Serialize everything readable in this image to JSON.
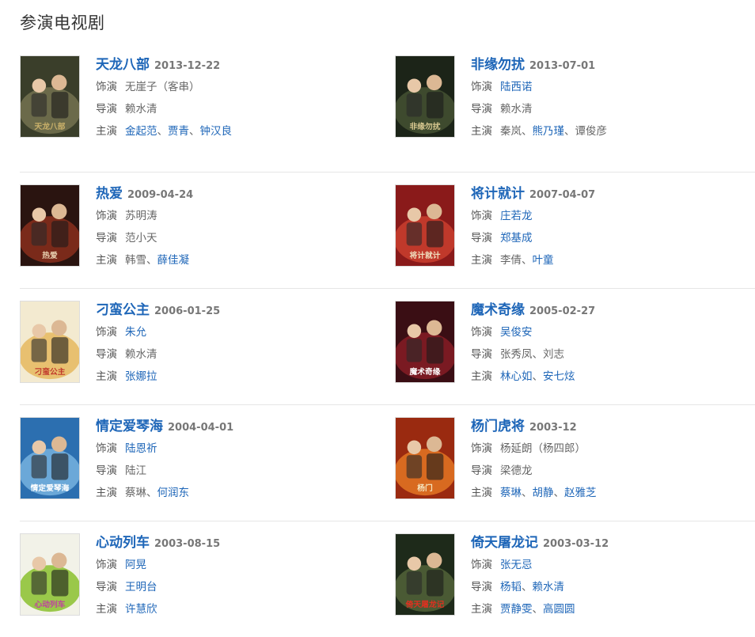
{
  "section": {
    "title": "参演电视剧"
  },
  "labels": {
    "role": "饰演",
    "director": "导演",
    "cast": "主演"
  },
  "separator": "、",
  "shows": [
    {
      "title": "天龙八部",
      "date": "2013-12-22",
      "role": [
        {
          "name": "无崖子（客串）",
          "link": false
        }
      ],
      "director": [
        {
          "name": "赖水清",
          "link": false
        }
      ],
      "cast": [
        {
          "name": "金起范",
          "link": true
        },
        {
          "name": "贾青",
          "link": true
        },
        {
          "name": "钟汉良",
          "link": true
        }
      ],
      "poster": {
        "bg": "#3a3e2a",
        "mid": "#6b6a4a",
        "accent": "#c9b06a",
        "text": "天龙八部"
      }
    },
    {
      "title": "非缘勿扰",
      "date": "2013-07-01",
      "role": [
        {
          "name": "陆西诺",
          "link": true
        }
      ],
      "director": [
        {
          "name": "赖水清",
          "link": false
        }
      ],
      "cast": [
        {
          "name": "秦岚",
          "link": false
        },
        {
          "name": "熊乃瑾",
          "link": true
        },
        {
          "name": "谭俊彦",
          "link": false
        }
      ],
      "poster": {
        "bg": "#1c2418",
        "mid": "#3e4a2e",
        "accent": "#d8c890",
        "text": "非缘勿扰"
      }
    },
    {
      "title": "热爱",
      "date": "2009-04-24",
      "role": [
        {
          "name": "苏明涛",
          "link": false
        }
      ],
      "director": [
        {
          "name": "范小天",
          "link": false
        }
      ],
      "cast": [
        {
          "name": "韩雪",
          "link": false
        },
        {
          "name": "薛佳凝",
          "link": true
        }
      ],
      "poster": {
        "bg": "#2a1410",
        "mid": "#7a2a1a",
        "accent": "#e8d0b0",
        "text": "热爱"
      }
    },
    {
      "title": "将计就计",
      "date": "2007-04-07",
      "role": [
        {
          "name": "庄若龙",
          "link": true
        }
      ],
      "director": [
        {
          "name": "郑基成",
          "link": true
        }
      ],
      "cast": [
        {
          "name": "李倩",
          "link": false
        },
        {
          "name": "叶童",
          "link": true
        }
      ],
      "poster": {
        "bg": "#8a1a1a",
        "mid": "#c0392b",
        "accent": "#f0e0c0",
        "text": "将计就计"
      }
    },
    {
      "title": "刁蛮公主",
      "date": "2006-01-25",
      "role": [
        {
          "name": "朱允",
          "link": true
        }
      ],
      "director": [
        {
          "name": "赖水清",
          "link": false
        }
      ],
      "cast": [
        {
          "name": "张娜拉",
          "link": true
        }
      ],
      "poster": {
        "bg": "#f3ead0",
        "mid": "#e8c070",
        "accent": "#c0392b",
        "text": "刁蛮公主"
      }
    },
    {
      "title": "魔术奇缘",
      "date": "2005-02-27",
      "role": [
        {
          "name": "吴俊安",
          "link": true
        }
      ],
      "director": [
        {
          "name": "张秀凤",
          "link": false
        },
        {
          "name": "刘志",
          "link": false
        }
      ],
      "cast": [
        {
          "name": "林心如",
          "link": true
        },
        {
          "name": "安七炫",
          "link": true
        }
      ],
      "poster": {
        "bg": "#3a0e14",
        "mid": "#7a1a22",
        "accent": "#ffffff",
        "text": "魔术奇缘"
      }
    },
    {
      "title": "情定爱琴海",
      "date": "2004-04-01",
      "role": [
        {
          "name": "陆恩祈",
          "link": true
        }
      ],
      "director": [
        {
          "name": "陆江",
          "link": false
        }
      ],
      "cast": [
        {
          "name": "蔡琳",
          "link": false
        },
        {
          "name": "何润东",
          "link": true
        }
      ],
      "poster": {
        "bg": "#2c6fb0",
        "mid": "#6ba8d8",
        "accent": "#ffffff",
        "text": "情定爱琴海"
      }
    },
    {
      "title": "杨门虎将",
      "date": "2003-12",
      "role": [
        {
          "name": "杨延朗（杨四郎）",
          "link": false
        }
      ],
      "director": [
        {
          "name": "梁德龙",
          "link": false
        }
      ],
      "cast": [
        {
          "name": "蔡琳",
          "link": true
        },
        {
          "name": "胡静",
          "link": true
        },
        {
          "name": "赵雅芝",
          "link": true
        }
      ],
      "poster": {
        "bg": "#9a2a10",
        "mid": "#d86a20",
        "accent": "#f5e6c0",
        "text": "杨门"
      }
    },
    {
      "title": "心动列车",
      "date": "2003-08-15",
      "role": [
        {
          "name": "阿晃",
          "link": true
        }
      ],
      "director": [
        {
          "name": "王明台",
          "link": true
        }
      ],
      "cast": [
        {
          "name": "许慧欣",
          "link": true
        }
      ],
      "poster": {
        "bg": "#f2f2e8",
        "mid": "#9ac84a",
        "accent": "#c040a0",
        "text": "心动列车"
      }
    },
    {
      "title": "倚天屠龙记",
      "date": "2003-03-12",
      "role": [
        {
          "name": "张无忌",
          "link": true
        }
      ],
      "director": [
        {
          "name": "杨韬",
          "link": true
        },
        {
          "name": "赖水清",
          "link": true
        }
      ],
      "cast": [
        {
          "name": "贾静雯",
          "link": true
        },
        {
          "name": "高圆圆",
          "link": true
        }
      ],
      "poster": {
        "bg": "#1e2a1a",
        "mid": "#4a5a34",
        "accent": "#e03020",
        "text": "倚天屠龙记"
      }
    }
  ]
}
